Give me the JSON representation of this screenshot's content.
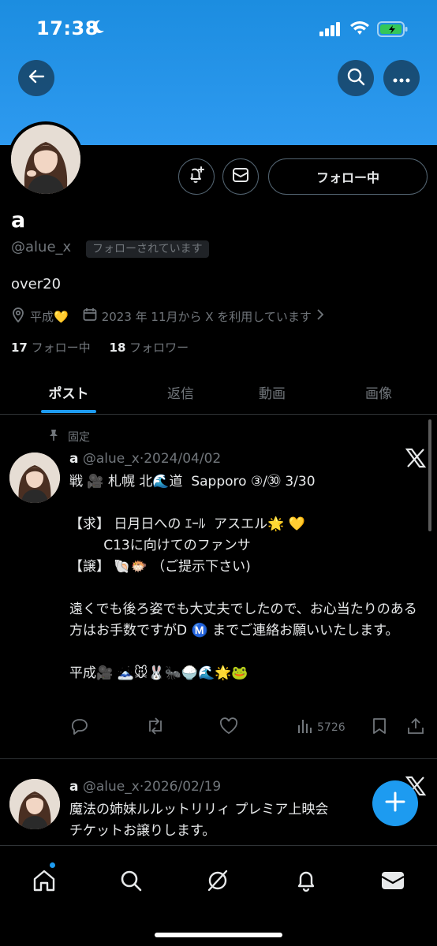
{
  "status_bar": {
    "time": "17:38",
    "icons": [
      "moon-icon",
      "signal-icon",
      "wifi-icon",
      "battery-charging-icon"
    ]
  },
  "header": {
    "back_icon": "back-arrow-icon",
    "search_icon": "search-icon",
    "more_icon": "more-icon",
    "banner_color": "#1d8fe6"
  },
  "profile": {
    "display_name": "a",
    "handle": "@alue_x",
    "follows_you_badge": "フォローされています",
    "bio": "over20",
    "location": "平成💛",
    "joined": "2023 年 11月から X を利用しています",
    "following_count": "17",
    "following_label": "フォロー中",
    "followers_count": "18",
    "followers_label": "フォロワー",
    "follow_button_label": "フォロー中"
  },
  "tabs": [
    {
      "label": "ポスト",
      "active": true
    },
    {
      "label": "返信",
      "active": false
    },
    {
      "label": "動画",
      "active": false
    },
    {
      "label": "画像",
      "active": false
    }
  ],
  "posts": [
    {
      "pinned_label": "固定",
      "name": "a",
      "handle": "@alue_x",
      "date": "·2024/04/02",
      "body": "戦 🎥 札幌 北🌊道  Sapporo ③/㉚ 3/30\n\n【求】 日月日への ｴｰﾙ  アスエル🌟 💛\n        C13に向けてのファンサ\n【譲】 🐚🐡 （ご提示下さい)\n\n遠くでも後ろ姿でも大丈夫でしたので、お心当たりのある方はお手数ですがD Ⓜ️ までご連絡お願いいたします。\n\n平成🎥 🗻🐭🐰🐜🍚🌊🌟🐸",
      "views": "5726"
    },
    {
      "name": "a",
      "handle": "@alue_x",
      "date": "·2026/02/19",
      "body": "魔法の姉妹ルルットリリィ プレミア上映会\nチケットお譲りします。"
    }
  ],
  "bottom_nav": [
    "home-icon",
    "search-icon",
    "grok-icon",
    "notifications-icon",
    "messages-icon"
  ],
  "accent_color": "#1d9bf0"
}
